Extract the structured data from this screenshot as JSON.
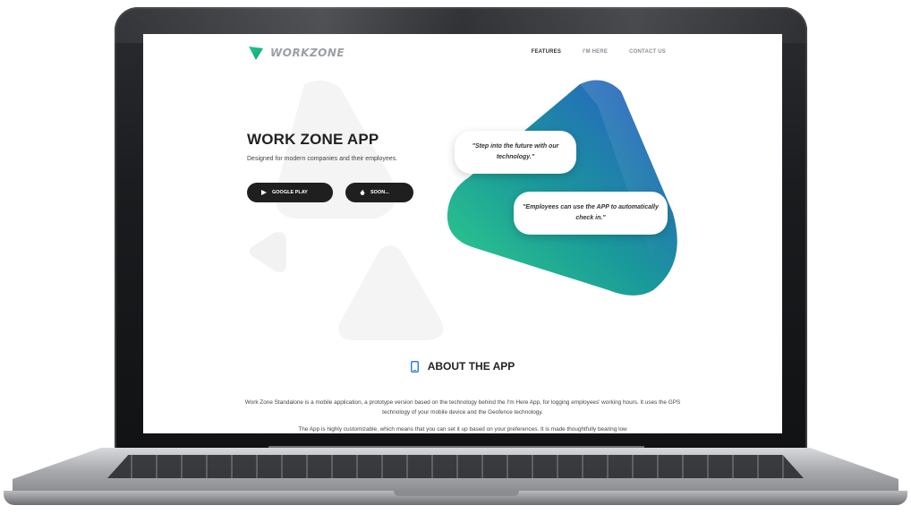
{
  "site": {
    "logo_text": "WORKZONE",
    "nav": [
      "FEATURES",
      "I'M HERE",
      "CONTACT US"
    ],
    "hero": {
      "title": "WORK ZONE APP",
      "subtitle": "Designed for modern companies and their employees.",
      "buttons": [
        "GOOGLE PLAY",
        "SOON..."
      ]
    },
    "bubbles": [
      "\"Step into the future with our technology.\"",
      "\"Employees can use the APP to automatically check in.\""
    ],
    "about": {
      "title": "ABOUT THE APP",
      "paragraph1": "Work Zone Standalone is a mobile application, a prototype version based on the technology behind the I'm Here App, for logging employees' working hours. It uses the GPS technology of your mobile device and the Geofence technology.",
      "paragraph2": "The App is highly customizable, which means that you can set it up based on your preferences. It is made thoughtfully bearing low"
    }
  },
  "icons": {
    "logo": "workzone-logo-icon",
    "play": "play-icon",
    "apple": "apple-icon",
    "phone": "phone-icon"
  },
  "colors": {
    "brand_green": "#2ecc8f",
    "brand_blue": "#2f5fd0",
    "button_dark": "#1f1f1f",
    "about_icon": "#2f7fe0"
  }
}
